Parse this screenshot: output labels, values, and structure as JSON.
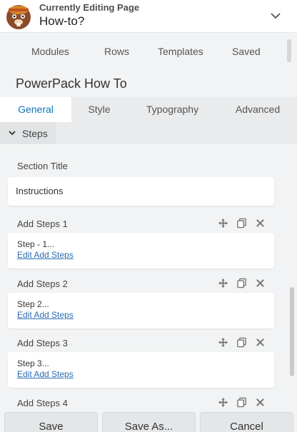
{
  "header": {
    "subtitle": "Currently Editing Page",
    "title": "How-to?"
  },
  "nav_tabs": [
    "Modules",
    "Rows",
    "Templates",
    "Saved"
  ],
  "module_title": "PowerPack How To",
  "settings_tabs": [
    "General",
    "Style",
    "Typography",
    "Advanced"
  ],
  "section": {
    "label": "Steps"
  },
  "section_title": {
    "label": "Section Title",
    "value": "Instructions"
  },
  "steps": [
    {
      "label": "Add Steps 1",
      "preview": "Step - 1...",
      "edit_link": "Edit Add Steps"
    },
    {
      "label": "Add Steps 2",
      "preview": "Step 2...",
      "edit_link": "Edit Add Steps"
    },
    {
      "label": "Add Steps 3",
      "preview": "Step 3...",
      "edit_link": "Edit Add Steps"
    },
    {
      "label": "Add Steps 4"
    }
  ],
  "footer": {
    "save": "Save",
    "save_as": "Save As...",
    "cancel": "Cancel"
  },
  "colors": {
    "accent": "#0e74b8",
    "link": "#2b6cb0",
    "background": "#f2f3f4"
  }
}
